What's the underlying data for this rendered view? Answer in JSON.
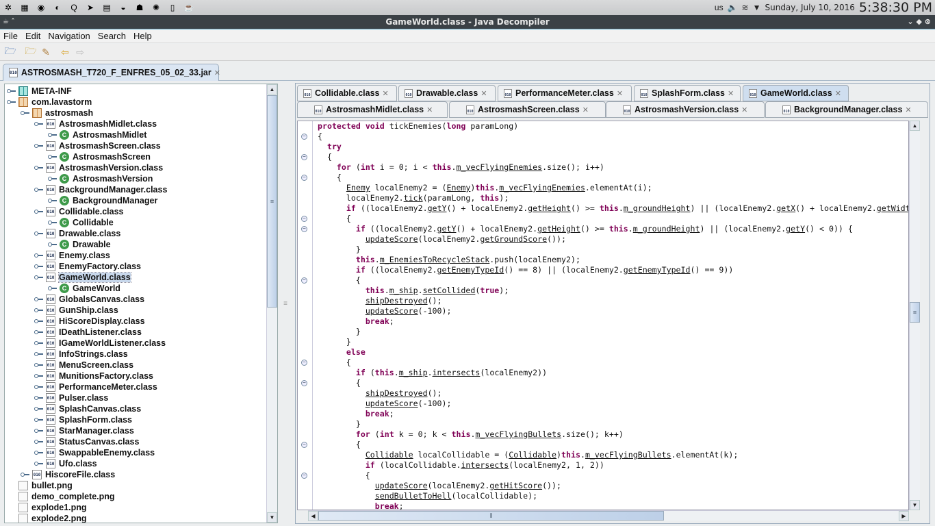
{
  "taskbar": {
    "apps": [
      "kde-menu-icon",
      "desktop-icon",
      "chrome-icon",
      "thunderbird-icon",
      "qt-creator-icon",
      "telegram-icon",
      "file-manager-icon",
      "eclipse-icon",
      "android-icon",
      "orange-icon",
      "notes-icon",
      "java-decompiler-icon"
    ],
    "tray": {
      "layout": "us",
      "date": "Sunday, July 10, 2016",
      "time": "5:38:30 PM"
    }
  },
  "window": {
    "title": "GameWorld.class - Java Decompiler"
  },
  "menu": [
    "File",
    "Edit",
    "Navigation",
    "Search",
    "Help"
  ],
  "toolbar": [
    "open-file-icon",
    "open-type-icon",
    "search-icon",
    "back-arrow-icon",
    "forward-arrow-icon"
  ],
  "jar_tab": {
    "label": "ASTROSMASH_T720_F_ENFRES_05_02_33.jar"
  },
  "tree": [
    {
      "label": "META-INF",
      "level": 0,
      "type": "meta"
    },
    {
      "label": "com.lavastorm",
      "level": 0,
      "type": "pkg"
    },
    {
      "label": "astrosmash",
      "level": 1,
      "type": "pkg"
    },
    {
      "label": "AstrosmashMidlet.class",
      "level": 2,
      "type": "cls"
    },
    {
      "label": "AstrosmashMidlet",
      "level": 3,
      "type": "cc"
    },
    {
      "label": "AstrosmashScreen.class",
      "level": 2,
      "type": "cls"
    },
    {
      "label": "AstrosmashScreen",
      "level": 3,
      "type": "cc"
    },
    {
      "label": "AstrosmashVersion.class",
      "level": 2,
      "type": "cls"
    },
    {
      "label": "AstrosmashVersion",
      "level": 3,
      "type": "cc"
    },
    {
      "label": "BackgroundManager.class",
      "level": 2,
      "type": "cls"
    },
    {
      "label": "BackgroundManager",
      "level": 3,
      "type": "cc"
    },
    {
      "label": "Collidable.class",
      "level": 2,
      "type": "cls"
    },
    {
      "label": "Collidable",
      "level": 3,
      "type": "cc"
    },
    {
      "label": "Drawable.class",
      "level": 2,
      "type": "cls"
    },
    {
      "label": "Drawable",
      "level": 3,
      "type": "cc"
    },
    {
      "label": "Enemy.class",
      "level": 2,
      "type": "cls"
    },
    {
      "label": "EnemyFactory.class",
      "level": 2,
      "type": "cls"
    },
    {
      "label": "GameWorld.class",
      "level": 2,
      "type": "cls",
      "selected": true
    },
    {
      "label": "GameWorld",
      "level": 3,
      "type": "cc"
    },
    {
      "label": "GlobalsCanvas.class",
      "level": 2,
      "type": "cls"
    },
    {
      "label": "GunShip.class",
      "level": 2,
      "type": "cls"
    },
    {
      "label": "HiScoreDisplay.class",
      "level": 2,
      "type": "cls"
    },
    {
      "label": "IDeathListener.class",
      "level": 2,
      "type": "cls"
    },
    {
      "label": "IGameWorldListener.class",
      "level": 2,
      "type": "cls"
    },
    {
      "label": "InfoStrings.class",
      "level": 2,
      "type": "cls"
    },
    {
      "label": "MenuScreen.class",
      "level": 2,
      "type": "cls"
    },
    {
      "label": "MunitionsFactory.class",
      "level": 2,
      "type": "cls"
    },
    {
      "label": "PerformanceMeter.class",
      "level": 2,
      "type": "cls"
    },
    {
      "label": "Pulser.class",
      "level": 2,
      "type": "cls"
    },
    {
      "label": "SplashCanvas.class",
      "level": 2,
      "type": "cls"
    },
    {
      "label": "SplashForm.class",
      "level": 2,
      "type": "cls"
    },
    {
      "label": "StarManager.class",
      "level": 2,
      "type": "cls"
    },
    {
      "label": "StatusCanvas.class",
      "level": 2,
      "type": "cls"
    },
    {
      "label": "SwappableEnemy.class",
      "level": 2,
      "type": "cls"
    },
    {
      "label": "Ufo.class",
      "level": 2,
      "type": "cls"
    },
    {
      "label": "HiscoreFile.class",
      "level": 1,
      "type": "cls"
    },
    {
      "label": "bullet.png",
      "level": 0,
      "type": "file"
    },
    {
      "label": "demo_complete.png",
      "level": 0,
      "type": "file"
    },
    {
      "label": "explode1.png",
      "level": 0,
      "type": "file"
    },
    {
      "label": "explode2.png",
      "level": 0,
      "type": "file"
    }
  ],
  "editor_tabs": {
    "row1": [
      {
        "label": "Collidable.class"
      },
      {
        "label": "Drawable.class"
      },
      {
        "label": "PerformanceMeter.class"
      },
      {
        "label": "SplashForm.class"
      },
      {
        "label": "GameWorld.class",
        "active": true
      }
    ],
    "row2": [
      {
        "label": "AstrosmashMidlet.class"
      },
      {
        "label": "AstrosmashScreen.class"
      },
      {
        "label": "AstrosmashVersion.class"
      },
      {
        "label": "BackgroundManager.class"
      }
    ]
  },
  "code": {
    "keywords": [
      "protected",
      "void",
      "long",
      "try",
      "for",
      "int",
      "this",
      "if",
      "true",
      "break",
      "else"
    ],
    "links": [
      "m_vecFlyingEnemies",
      "Enemy",
      "tick",
      "getY",
      "getHeight",
      "m_groundHeight",
      "getX",
      "getWidt",
      "getGroundScore",
      "m_EnemiesToRecycleStack",
      "getEnemyTypeId",
      "m_ship",
      "setCollided",
      "shipDestroyed",
      "updateScore",
      "intersects",
      "m_vecFlyingBullets",
      "Collidable",
      "sendBulletToHell",
      "getHitScore"
    ],
    "folds": [
      1,
      3,
      5,
      9,
      10,
      15,
      23,
      25,
      31,
      34
    ],
    "lines": [
      "protected void tickEnemies(long paramLong)",
      "{",
      "  try",
      "  {",
      "    for (int i = 0; i < this.m_vecFlyingEnemies.size(); i++)",
      "    {",
      "      Enemy localEnemy2 = (Enemy)this.m_vecFlyingEnemies.elementAt(i);",
      "      localEnemy2.tick(paramLong, this);",
      "      if ((localEnemy2.getY() + localEnemy2.getHeight() >= this.m_groundHeight) || (localEnemy2.getX() + localEnemy2.getWidt",
      "      {",
      "        if ((localEnemy2.getY() + localEnemy2.getHeight() >= this.m_groundHeight) || (localEnemy2.getY() < 0)) {",
      "          updateScore(localEnemy2.getGroundScore());",
      "        }",
      "        this.m_EnemiesToRecycleStack.push(localEnemy2);",
      "        if ((localEnemy2.getEnemyTypeId() == 8) || (localEnemy2.getEnemyTypeId() == 9))",
      "        {",
      "          this.m_ship.setCollided(true);",
      "          shipDestroyed();",
      "          updateScore(-100);",
      "          break;",
      "        }",
      "      }",
      "      else",
      "      {",
      "        if (this.m_ship.intersects(localEnemy2))",
      "        {",
      "          shipDestroyed();",
      "          updateScore(-100);",
      "          break;",
      "        }",
      "        for (int k = 0; k < this.m_vecFlyingBullets.size(); k++)",
      "        {",
      "          Collidable localCollidable = (Collidable)this.m_vecFlyingBullets.elementAt(k);",
      "          if (localCollidable.intersects(localEnemy2, 1, 2))",
      "          {",
      "            updateScore(localEnemy2.getHitScore());",
      "            sendBulletToHell(localCollidable);",
      "            break;"
    ]
  },
  "colors": {
    "keyword": "#7f0055",
    "selection": "#c8d8ec",
    "titlebar": "#3b4146"
  }
}
